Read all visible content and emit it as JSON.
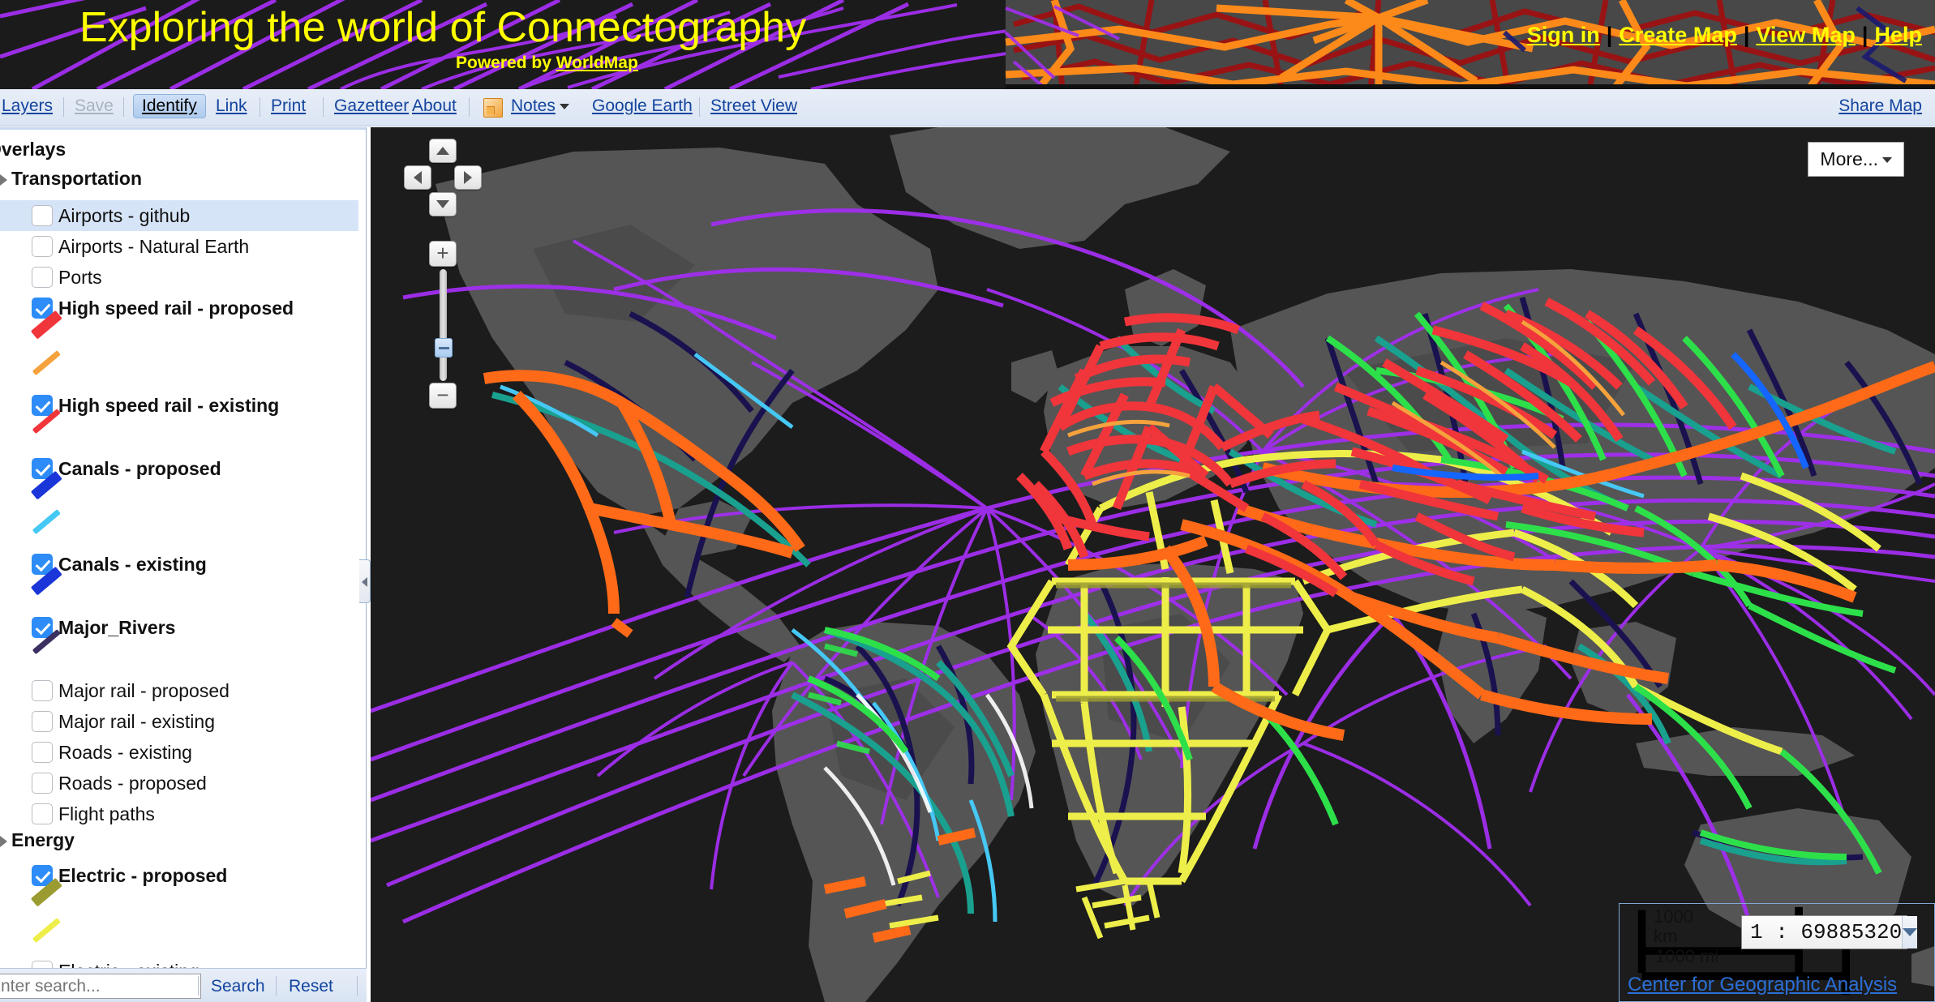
{
  "banner": {
    "title": "Exploring the world of Connectography",
    "powered_prefix": "Powered by ",
    "powered_link": "WorldMap",
    "links": [
      {
        "label": "Sign in",
        "name": "sign-in-link"
      },
      {
        "label": "Create Map",
        "name": "create-map-link"
      },
      {
        "label": "View Map",
        "name": "view-map-link"
      },
      {
        "label": "Help",
        "name": "help-link"
      }
    ]
  },
  "toolbar": {
    "layers": "Layers",
    "save": "Save",
    "identify": "Identify",
    "link": "Link",
    "print": "Print",
    "gazetteer": "Gazetteer",
    "about": "About",
    "notes": "Notes",
    "notes_icon": "note-icon",
    "google_earth": "Google Earth",
    "street_view": "Street View",
    "share_map": "Share Map"
  },
  "sidebar": {
    "root_label": "Overlays",
    "groups": [
      {
        "label": "Transportation",
        "items": [
          {
            "label": "Airports - github",
            "checked": false,
            "highlighted": true,
            "swatches": []
          },
          {
            "label": "Airports - Natural Earth",
            "checked": false,
            "highlighted": false,
            "swatches": []
          },
          {
            "label": "Ports",
            "checked": false,
            "highlighted": false,
            "swatches": []
          },
          {
            "label": "High speed rail - proposed",
            "checked": true,
            "highlighted": false,
            "swatches": [
              {
                "color": "#f0353b",
                "weight": "thick"
              },
              {
                "color": "#f5a23c",
                "weight": "thin"
              }
            ]
          },
          {
            "label": "High speed rail - existing",
            "checked": true,
            "highlighted": false,
            "swatches": [
              {
                "color": "#f0353b",
                "weight": "thin"
              }
            ]
          },
          {
            "label": "Canals - proposed",
            "checked": true,
            "highlighted": false,
            "swatches": [
              {
                "color": "#1a35d8",
                "weight": "thick"
              },
              {
                "color": "#46c8f5",
                "weight": "thin"
              }
            ]
          },
          {
            "label": "Canals - existing",
            "checked": true,
            "highlighted": false,
            "swatches": [
              {
                "color": "#1a35d8",
                "weight": "thick"
              }
            ]
          },
          {
            "label": "Major_Rivers",
            "checked": true,
            "highlighted": false,
            "swatches": [
              {
                "color": "#3b3060",
                "weight": "thin"
              }
            ]
          },
          {
            "label": "Major rail - proposed",
            "checked": false,
            "highlighted": false,
            "swatches": []
          },
          {
            "label": "Major rail - existing",
            "checked": false,
            "highlighted": false,
            "swatches": []
          },
          {
            "label": "Roads - existing",
            "checked": false,
            "highlighted": false,
            "swatches": []
          },
          {
            "label": "Roads - proposed",
            "checked": false,
            "highlighted": false,
            "swatches": []
          },
          {
            "label": "Flight paths",
            "checked": false,
            "highlighted": false,
            "swatches": []
          }
        ]
      },
      {
        "label": "Energy",
        "items": [
          {
            "label": "Electric - proposed",
            "checked": true,
            "highlighted": false,
            "swatches": [
              {
                "color": "#9a9b31",
                "weight": "thick"
              },
              {
                "color": "#eeee4a",
                "weight": "thin"
              }
            ]
          },
          {
            "label": "Electric - existing",
            "checked": false,
            "highlighted": false,
            "swatches": []
          }
        ]
      }
    ],
    "search": {
      "placeholder": "Enter search...",
      "search_label": "Search",
      "reset_label": "Reset"
    }
  },
  "map": {
    "more_label": "More...",
    "pan_up": "pan-up",
    "pan_down": "pan-down",
    "pan_left": "pan-left",
    "pan_right": "pan-right",
    "zoom_in": "+",
    "zoom_out": "−",
    "scale": {
      "km_label": "1000\nkm",
      "km_text": "1000",
      "km_unit": "km",
      "mi_label": "1000 mi",
      "ratio": "1 : 69885320"
    },
    "attribution": "Center for Geographic Analysis",
    "background_color": "#1c1c1c",
    "land_color": "#585858",
    "layer_colors": {
      "high_speed_rail_proposed": "#f0353b",
      "high_speed_rail_existing": "#ff6a18",
      "canals_proposed": "#1a35d8",
      "canals_existing": "#46c8f5",
      "major_rivers": "#19124f",
      "electric_proposed": "#eeee4a",
      "flight_paths": "#a22ef0",
      "pipelines_green": "#2de04a",
      "pipelines_teal": "#1aa08f"
    }
  }
}
